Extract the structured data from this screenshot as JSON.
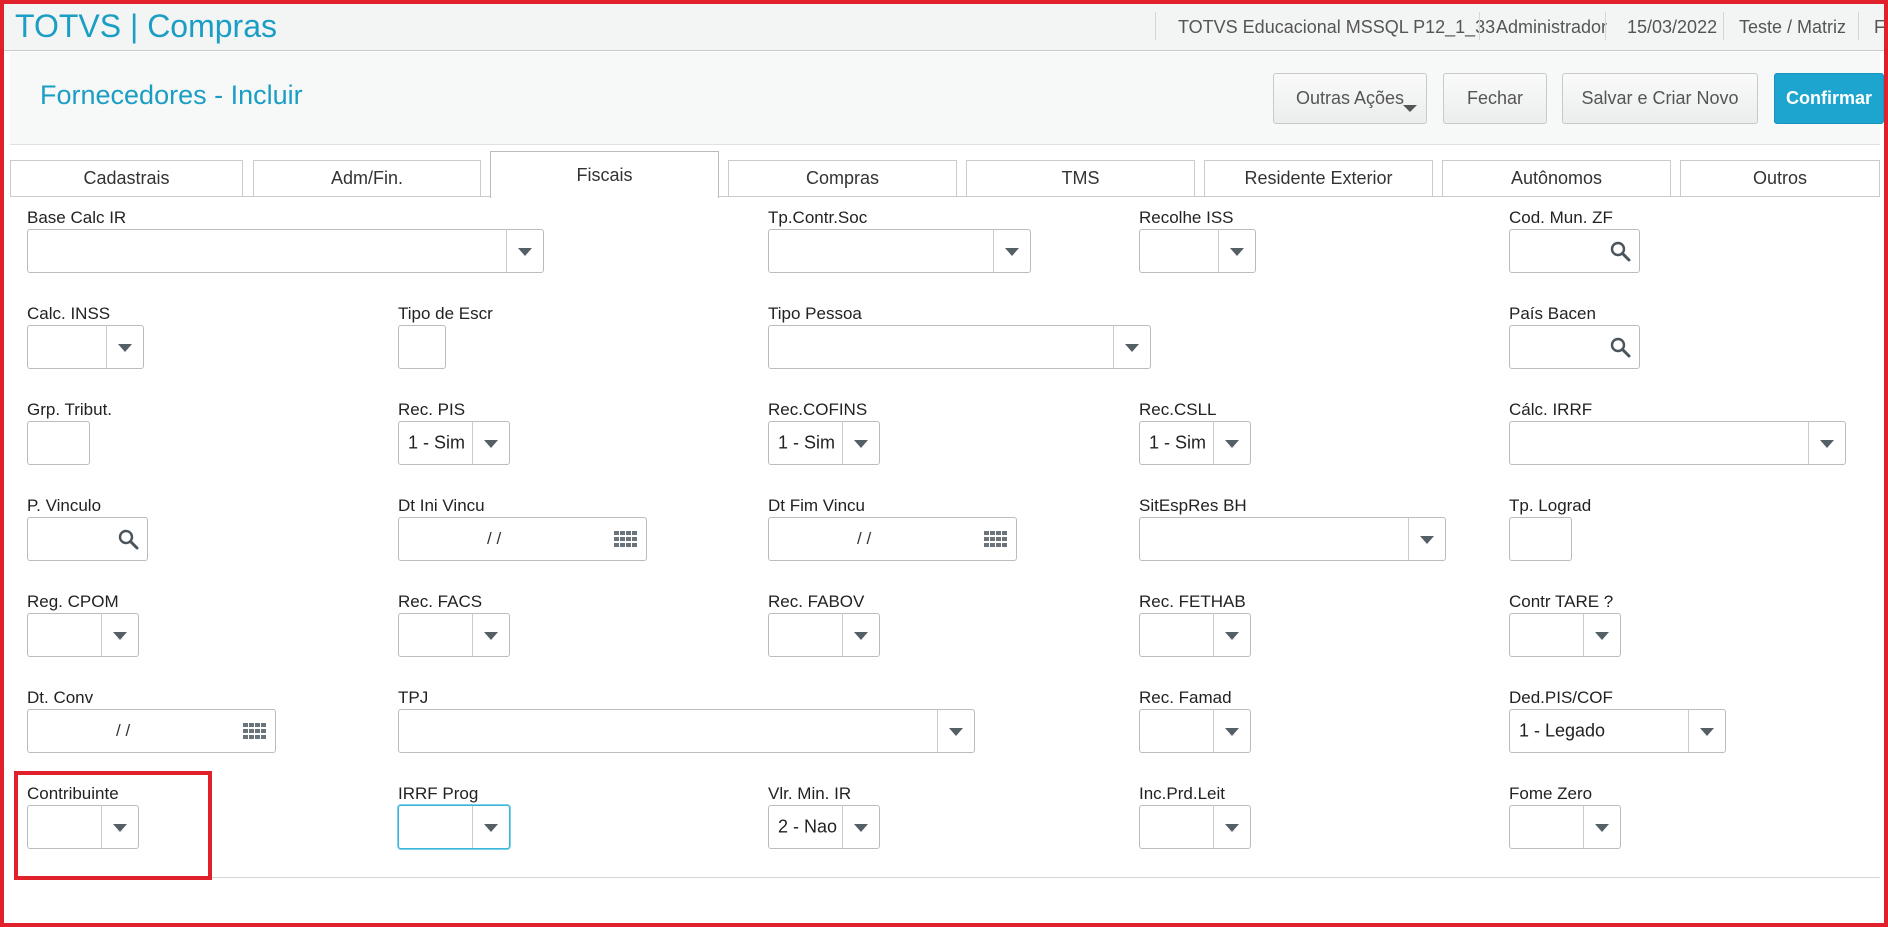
{
  "topbar": {
    "app_title": "TOTVS | Compras",
    "environment": "TOTVS Educacional MSSQL P12_1_33",
    "user": "Administrador",
    "date": "15/03/2022",
    "branch": "Teste / Matriz",
    "truncated": "F"
  },
  "header": {
    "page_title": "Fornecedores - Incluir",
    "buttons": {
      "more_actions": "Outras Ações",
      "close": "Fechar",
      "save_new": "Salvar e Criar Novo",
      "confirm": "Confirmar"
    }
  },
  "tabs": [
    "Cadastrais",
    "Adm/Fin.",
    "Fiscais",
    "Compras",
    "TMS",
    "Residente Exterior",
    "Autônomos",
    "Outros"
  ],
  "active_tab": "Fiscais",
  "fields": {
    "base_calc_ir": {
      "label": "Base Calc IR",
      "value": ""
    },
    "tp_contr_soc": {
      "label": "Tp.Contr.Soc",
      "value": ""
    },
    "recolhe_iss": {
      "label": "Recolhe ISS",
      "value": ""
    },
    "cod_mun_zf": {
      "label": "Cod. Mun. ZF",
      "value": ""
    },
    "calc_inss": {
      "label": "Calc. INSS",
      "value": ""
    },
    "tipo_escr": {
      "label": "Tipo de Escr",
      "value": ""
    },
    "tipo_pessoa": {
      "label": "Tipo Pessoa",
      "value": ""
    },
    "pais_bacen": {
      "label": "País Bacen",
      "value": ""
    },
    "grp_tribut": {
      "label": "Grp. Tribut.",
      "value": ""
    },
    "rec_pis": {
      "label": "Rec. PIS",
      "value": "1 - Sim"
    },
    "rec_cofins": {
      "label": "Rec.COFINS",
      "value": "1 - Sim"
    },
    "rec_csll": {
      "label": "Rec.CSLL",
      "value": "1 - Sim"
    },
    "calc_irrf": {
      "label": "Cálc. IRRF",
      "value": ""
    },
    "p_vinculo": {
      "label": "P. Vinculo",
      "value": ""
    },
    "dt_ini_vincu": {
      "label": "Dt Ini Vincu",
      "value": "/ /"
    },
    "dt_fim_vincu": {
      "label": "Dt Fim Vincu",
      "value": "/ /"
    },
    "sit_esp_res_bh": {
      "label": "SitEspRes BH",
      "value": ""
    },
    "tp_lograd": {
      "label": "Tp. Lograd",
      "value": ""
    },
    "reg_cpom": {
      "label": "Reg. CPOM",
      "value": ""
    },
    "rec_facs": {
      "label": "Rec. FACS",
      "value": ""
    },
    "rec_fabov": {
      "label": "Rec. FABOV",
      "value": ""
    },
    "rec_fethab": {
      "label": "Rec. FETHAB",
      "value": ""
    },
    "contr_tare": {
      "label": "Contr TARE ?",
      "value": ""
    },
    "dt_conv": {
      "label": "Dt. Conv",
      "value": "/ /"
    },
    "tpj": {
      "label": "TPJ",
      "value": ""
    },
    "rec_famad": {
      "label": "Rec. Famad",
      "value": ""
    },
    "ded_pis_cof": {
      "label": "Ded.PIS/COF",
      "value": "1 - Legado"
    },
    "contribuinte": {
      "label": "Contribuinte",
      "value": ""
    },
    "irrf_prog": {
      "label": "IRRF Prog",
      "value": ""
    },
    "vlr_min_ir": {
      "label": "Vlr. Min. IR",
      "value": "2 - Nao"
    },
    "inc_prd_leit": {
      "label": "Inc.Prd.Leit",
      "value": ""
    },
    "fome_zero": {
      "label": "Fome Zero",
      "value": ""
    }
  },
  "colors": {
    "brand": "#1b9ec4",
    "confirm": "#1ea5cf",
    "highlight": "#e0202a"
  },
  "icons": [
    "search-icon",
    "calendar-icon",
    "chevron-down-icon"
  ]
}
